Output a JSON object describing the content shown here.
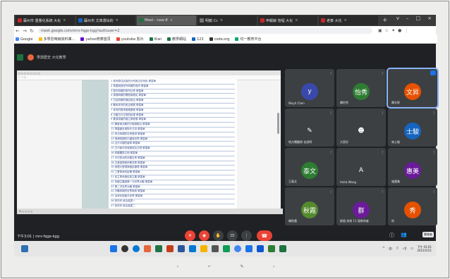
{
  "tabs": [
    {
      "label": "蘇州市 重量化系統 大化",
      "color": "#c62828",
      "active": false
    },
    {
      "label": "蘇州市 文章選出的",
      "color": "#1565c0",
      "active": false
    },
    {
      "label": "Meet - new-8",
      "color": "#1a7340",
      "active": true
    },
    {
      "label": "明鏡 Cc",
      "color": "#757575",
      "active": false
    },
    {
      "label": "申報線 管程 大化",
      "color": "#c62828",
      "active": false
    },
    {
      "label": "老泰 大化",
      "color": "#c62828",
      "active": false
    }
  ],
  "new_tab_label": "+",
  "window_controls": [
    "v",
    "–",
    "□",
    "×"
  ],
  "address": "meet.google.com/mrv-fqge-kgg?authuser=2",
  "bookmarks": [
    {
      "label": "Google",
      "color": "#4285f4"
    },
    {
      "label": "多學習時線資料庫...",
      "color": "#fbbc05"
    },
    {
      "label": "yahoo奇摩首頁",
      "color": "#6001d2"
    },
    {
      "label": "youtube 影片",
      "color": "#ea4335"
    },
    {
      "label": "Kiwi",
      "color": "#1a7340"
    },
    {
      "label": "教學網站",
      "color": "#1a7340"
    },
    {
      "label": "123",
      "color": "#1565c0"
    },
    {
      "label": "code.org",
      "color": "#333333"
    },
    {
      "label": "均一教育平台",
      "color": "#00a86b"
    }
  ],
  "meeting_title": "學測歷史 大化教學",
  "tiles": [
    {
      "name": "Wuyh Chen",
      "initial": "y",
      "color": "#3949ab",
      "active": false
    },
    {
      "name": "賴怡秀",
      "initial": "怡秀",
      "color": "#2e7d32",
      "active": false
    },
    {
      "name": "陳文昇",
      "initial": "文昇",
      "color": "#e65100",
      "active": true
    },
    {
      "name": "地方關鍵詞 化說明",
      "initial": "✎",
      "color": "#3c4043",
      "active": false
    },
    {
      "name": "大家好",
      "initial": "☻",
      "color": "#3c4043",
      "active": false
    },
    {
      "name": "林士駿",
      "initial": "士駿",
      "color": "#1565c0",
      "active": false
    },
    {
      "name": "王泰文",
      "initial": "泰文",
      "color": "#2e7d32",
      "active": false
    },
    {
      "name": "Anita Wang",
      "initial": "A",
      "color": "#3c4043",
      "active": false
    },
    {
      "name": "施惠美",
      "initial": "惠美",
      "color": "#6a1b9a",
      "active": false
    },
    {
      "name": "賴秋霞",
      "initial": "秋霞",
      "color": "#558b2f",
      "active": false
    },
    {
      "name": "群組 其他 11 個參與者",
      "initial": "群",
      "color": "#6a1b9a",
      "active": false
    },
    {
      "name": "你",
      "initial": "秀",
      "color": "#e65100",
      "active": false
    }
  ],
  "doc_lines": [
    "1 臺灣原住民族的分布與文化特色 學習單",
    "2 荷蘭與西班牙時期的臺灣 學習單",
    "3 鄭氏時期的臺灣社會 學習單",
    "4 清領時期的開發與移民 學習單",
    "5 日治時期的殖民統治 學習單",
    "6 戰後臺灣的政治發展 學習單",
    "7 臺灣的經濟發展歷程 學習單",
    "8 中國古代文明的起源 學習單",
    "9 秦漢帝國的建立與發展 學習單",
    "10 魏晉南北朝的分裂與融合 學習單",
    "11 隋唐盛世與對外交流 學習單",
    "12 宋元時期的社會經濟 學習單",
    "13 明清時期的中國與世界 學習單",
    "14 近代中國的變革 學習單",
    "15 古代兩河流域與埃及文明 學習單",
    "16 希臘羅馬文明 學習單",
    "17 中古歐洲的封建社會 學習單",
    "18 文藝復興與宗教改革 學習單",
    "19 地理大發現與殖民擴張 學習單",
    "20 工業革命的影響 學習單",
    "21 民主革命與民族主義 學習單",
    "22 帝國主義與第一次世界大戰 學習單",
    "23 第二次世界大戰 學習單",
    "24 冷戰時期的世界局勢 學習單",
    "25 全球化與當代世界 學習單",
    "26 臺灣史 綜合複習一",
    "27 臺灣史 綜合複習二",
    "28 中國史 綜合複習一",
    "29 中國史 綜合複習二",
    "30 世界史 綜合複習一"
  ],
  "meeting_info": "下午3:01 | mrv-fqge-kgg",
  "present_label": "簡報者",
  "clock_time": "下午 03:01",
  "clock_date": "2021/5/21",
  "colors": {
    "meet_bg": "#202124",
    "tile_bg": "#3c4043",
    "hangup": "#ea4335"
  }
}
